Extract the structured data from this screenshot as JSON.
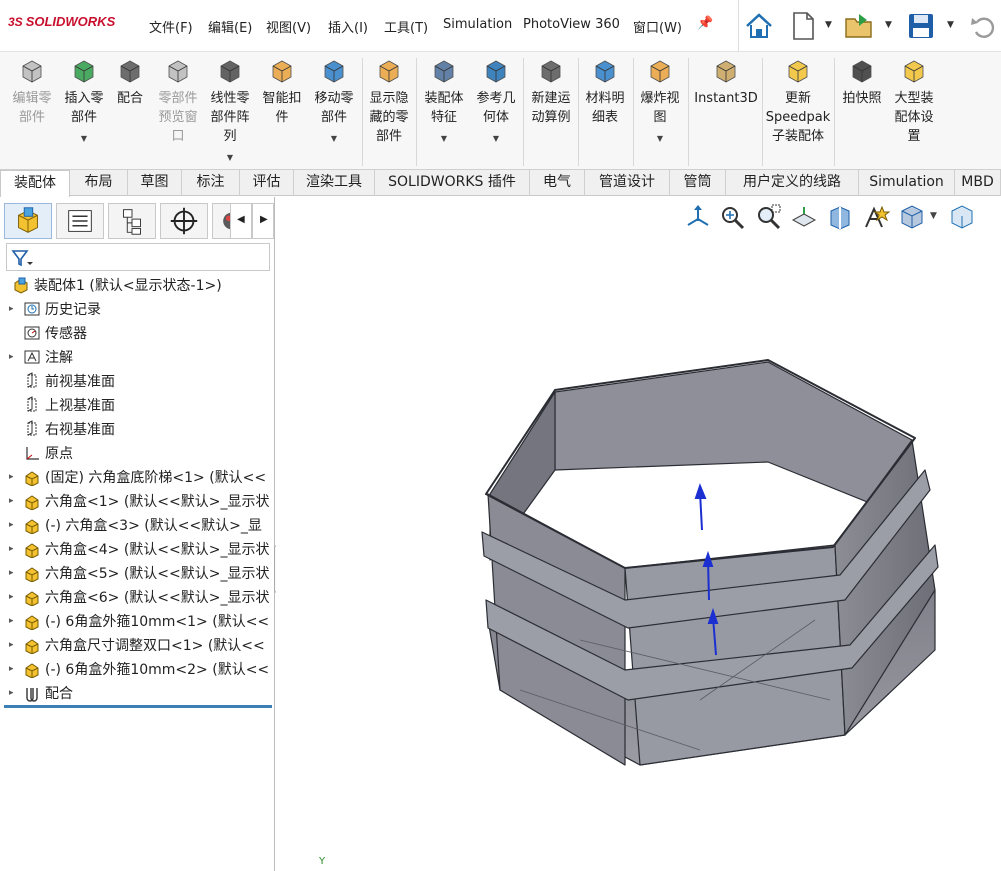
{
  "app": {
    "logo_text": "SOLIDWORKS",
    "logo_prefix": "3S"
  },
  "menu": [
    "文件(F)",
    "编辑(E)",
    "视图(V)",
    "插入(I)",
    "工具(T)",
    "Simulation",
    "PhotoView 360",
    "窗口(W)"
  ],
  "ribbon": {
    "buttons": [
      {
        "line1": "编辑零",
        "line2": "部件",
        "line3": "",
        "enabled": false
      },
      {
        "line1": "插入零",
        "line2": "部件",
        "line3": "",
        "enabled": true
      },
      {
        "line1": "配合",
        "line2": "",
        "line3": "",
        "enabled": true
      },
      {
        "line1": "零部件",
        "line2": "预览窗",
        "line3": "口",
        "enabled": false
      },
      {
        "line1": "线性零",
        "line2": "部件阵",
        "line3": "列",
        "enabled": true
      },
      {
        "line1": "智能扣",
        "line2": "件",
        "line3": "",
        "enabled": true
      },
      {
        "line1": "移动零",
        "line2": "部件",
        "line3": "",
        "enabled": true
      },
      {
        "line1": "显示隐",
        "line2": "藏的零",
        "line3": "部件",
        "enabled": true
      },
      {
        "line1": "装配体",
        "line2": "特征",
        "line3": "",
        "enabled": true
      },
      {
        "line1": "参考几",
        "line2": "何体",
        "line3": "",
        "enabled": true
      },
      {
        "line1": "新建运",
        "line2": "动算例",
        "line3": "",
        "enabled": true
      },
      {
        "line1": "材料明",
        "line2": "细表",
        "line3": "",
        "enabled": true
      },
      {
        "line1": "爆炸视",
        "line2": "图",
        "line3": "",
        "enabled": true
      },
      {
        "line1": "Instant3D",
        "line2": "",
        "line3": "",
        "enabled": true
      },
      {
        "line1": "更新",
        "line2": "Speedpak",
        "line3": "子装配体",
        "enabled": true
      },
      {
        "line1": "拍快照",
        "line2": "",
        "line3": "",
        "enabled": true
      },
      {
        "line1": "大型装",
        "line2": "配体设",
        "line3": "置",
        "enabled": true
      }
    ]
  },
  "tabs": [
    "装配体",
    "布局",
    "草图",
    "标注",
    "评估",
    "渲染工具",
    "SOLIDWORKS 插件",
    "电气",
    "管道设计",
    "管筒",
    "用户定义的线路",
    "Simulation",
    "MBD"
  ],
  "active_tab": "装配体",
  "tree": {
    "root": "装配体1  (默认<显示状态-1>)",
    "items": [
      {
        "label": "历史记录",
        "icon": "history-icon",
        "expand": true
      },
      {
        "label": "传感器",
        "icon": "sensor-icon",
        "expand": false
      },
      {
        "label": "注解",
        "icon": "annotation-icon",
        "expand": true
      },
      {
        "label": "前视基准面",
        "icon": "plane-icon",
        "expand": false
      },
      {
        "label": "上视基准面",
        "icon": "plane-icon",
        "expand": false
      },
      {
        "label": "右视基准面",
        "icon": "plane-icon",
        "expand": false
      },
      {
        "label": "原点",
        "icon": "origin-icon",
        "expand": false
      },
      {
        "label": "(固定) 六角盒底阶梯<1> (默认<<",
        "icon": "part-icon",
        "expand": true
      },
      {
        "label": "六角盒<1> (默认<<默认>_显示状",
        "icon": "part-icon",
        "expand": true
      },
      {
        "label": "(-) 六角盒<3> (默认<<默认>_显",
        "icon": "part-icon",
        "expand": true
      },
      {
        "label": "六角盒<4> (默认<<默认>_显示状",
        "icon": "part-icon",
        "expand": true
      },
      {
        "label": "六角盒<5> (默认<<默认>_显示状",
        "icon": "part-icon",
        "expand": true
      },
      {
        "label": "六角盒<6> (默认<<默认>_显示状",
        "icon": "part-icon",
        "expand": true
      },
      {
        "label": "(-) 6角盒外箍10mm<1> (默认<<",
        "icon": "part-icon",
        "expand": true
      },
      {
        "label": "六角盒尺寸调整双口<1> (默认<<",
        "icon": "part-icon",
        "expand": true
      },
      {
        "label": "(-) 6角盒外箍10mm<2> (默认<<",
        "icon": "part-icon",
        "expand": true
      },
      {
        "label": "配合",
        "icon": "mates-icon",
        "expand": true
      }
    ]
  },
  "viewport": {
    "triad_label": "Y"
  },
  "colors": {
    "accent": "#c8102e",
    "model_fill": "#8f9099",
    "model_edge": "#2b2d34",
    "selection": "#3c7fb6"
  }
}
